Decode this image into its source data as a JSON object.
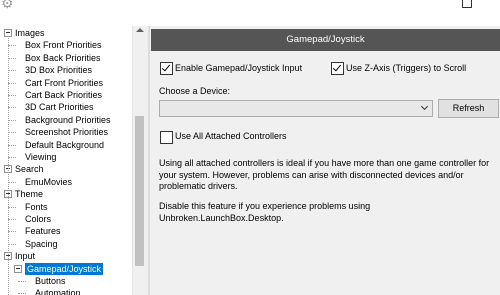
{
  "tree": {
    "items": [
      {
        "label": "Images",
        "level": 0,
        "expander": true
      },
      {
        "label": "Box Front Priorities",
        "level": 1
      },
      {
        "label": "Box Back Priorities",
        "level": 1
      },
      {
        "label": "3D Box Priorities",
        "level": 1
      },
      {
        "label": "Cart Front Priorities",
        "level": 1
      },
      {
        "label": "Cart Back Priorities",
        "level": 1
      },
      {
        "label": "3D Cart Priorities",
        "level": 1
      },
      {
        "label": "Background Priorities",
        "level": 1
      },
      {
        "label": "Screenshot Priorities",
        "level": 1
      },
      {
        "label": "Default Background",
        "level": 1
      },
      {
        "label": "Viewing",
        "level": 1
      },
      {
        "label": "Search",
        "level": 0,
        "expander": true
      },
      {
        "label": "EmuMovies",
        "level": 1
      },
      {
        "label": "Theme",
        "level": 0,
        "expander": true
      },
      {
        "label": "Fonts",
        "level": 1
      },
      {
        "label": "Colors",
        "level": 1
      },
      {
        "label": "Features",
        "level": 1
      },
      {
        "label": "Spacing",
        "level": 1
      },
      {
        "label": "Input",
        "level": 0,
        "expander": true
      },
      {
        "label": "Gamepad/Joystick",
        "level": 1,
        "expander": true,
        "selected": true
      },
      {
        "label": "Buttons",
        "level": 2
      },
      {
        "label": "Automation",
        "level": 2
      }
    ]
  },
  "panel": {
    "title": "Gamepad/Joystick",
    "enable_label": "Enable Gamepad/Joystick Input",
    "enable_checked": true,
    "zaxis_label": "Use Z-Axis (Triggers) to Scroll",
    "zaxis_checked": true,
    "device_label": "Choose a Device:",
    "device_value": "",
    "refresh_label": "Refresh",
    "all_controllers_label": "Use All Attached Controllers",
    "all_controllers_checked": false,
    "description_1": "Using all attached controllers is ideal if you have more than one game controller for your system. However, problems can arise with disconnected devices and/or problematic drivers.",
    "description_2": "Disable this feature if you experience problems using Unbroken.LaunchBox.Desktop."
  },
  "colors": {
    "header_bg": "#555555",
    "selection": "#0078d7"
  }
}
